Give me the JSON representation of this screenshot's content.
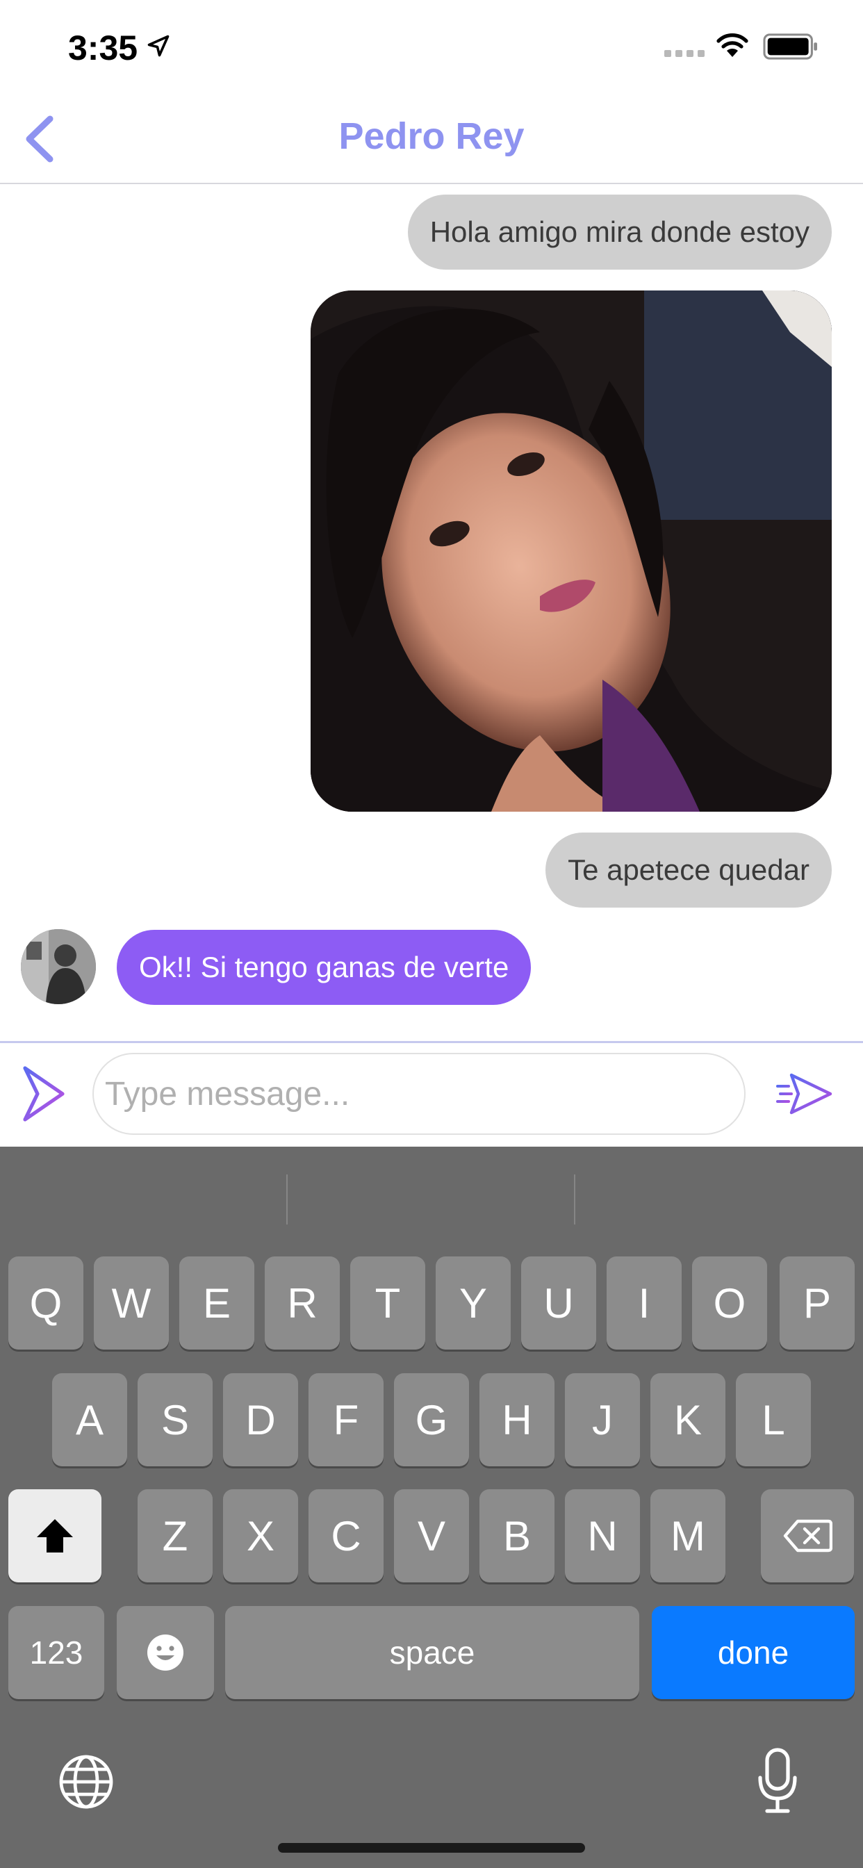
{
  "status_bar": {
    "time": "3:35",
    "icons": [
      "location-arrow-icon",
      "signal-icon",
      "wifi-icon",
      "battery-icon"
    ]
  },
  "header": {
    "title": "Pedro Rey",
    "back_icon": "chevron-left-icon"
  },
  "messages": [
    {
      "direction": "outgoing",
      "type": "text",
      "text": "Hola amigo mira donde estoy"
    },
    {
      "direction": "outgoing",
      "type": "image"
    },
    {
      "direction": "outgoing",
      "type": "text",
      "text": "Te apetece quedar"
    },
    {
      "direction": "incoming",
      "type": "text",
      "text": "Ok!! Si tengo ganas de verte"
    }
  ],
  "composer": {
    "placeholder": "Type message...",
    "expand_icon": "chevron-right-icon",
    "send_icon": "send-plane-icon"
  },
  "keyboard": {
    "row1": [
      "Q",
      "W",
      "E",
      "R",
      "T",
      "Y",
      "U",
      "I",
      "O",
      "P"
    ],
    "row2": [
      "A",
      "S",
      "D",
      "F",
      "G",
      "H",
      "J",
      "K",
      "L"
    ],
    "row3": [
      "Z",
      "X",
      "C",
      "V",
      "B",
      "N",
      "M"
    ],
    "numbers_label": "123",
    "space_label": "space",
    "done_label": "done",
    "icons": [
      "shift-icon",
      "backspace-icon",
      "emoji-icon",
      "globe-icon",
      "microphone-icon"
    ]
  },
  "colors": {
    "accent": "#8e93f0",
    "incoming_bubble": "#8d5cf4",
    "outgoing_bubble": "#cfcfcf",
    "done_key": "#0a7aff"
  }
}
